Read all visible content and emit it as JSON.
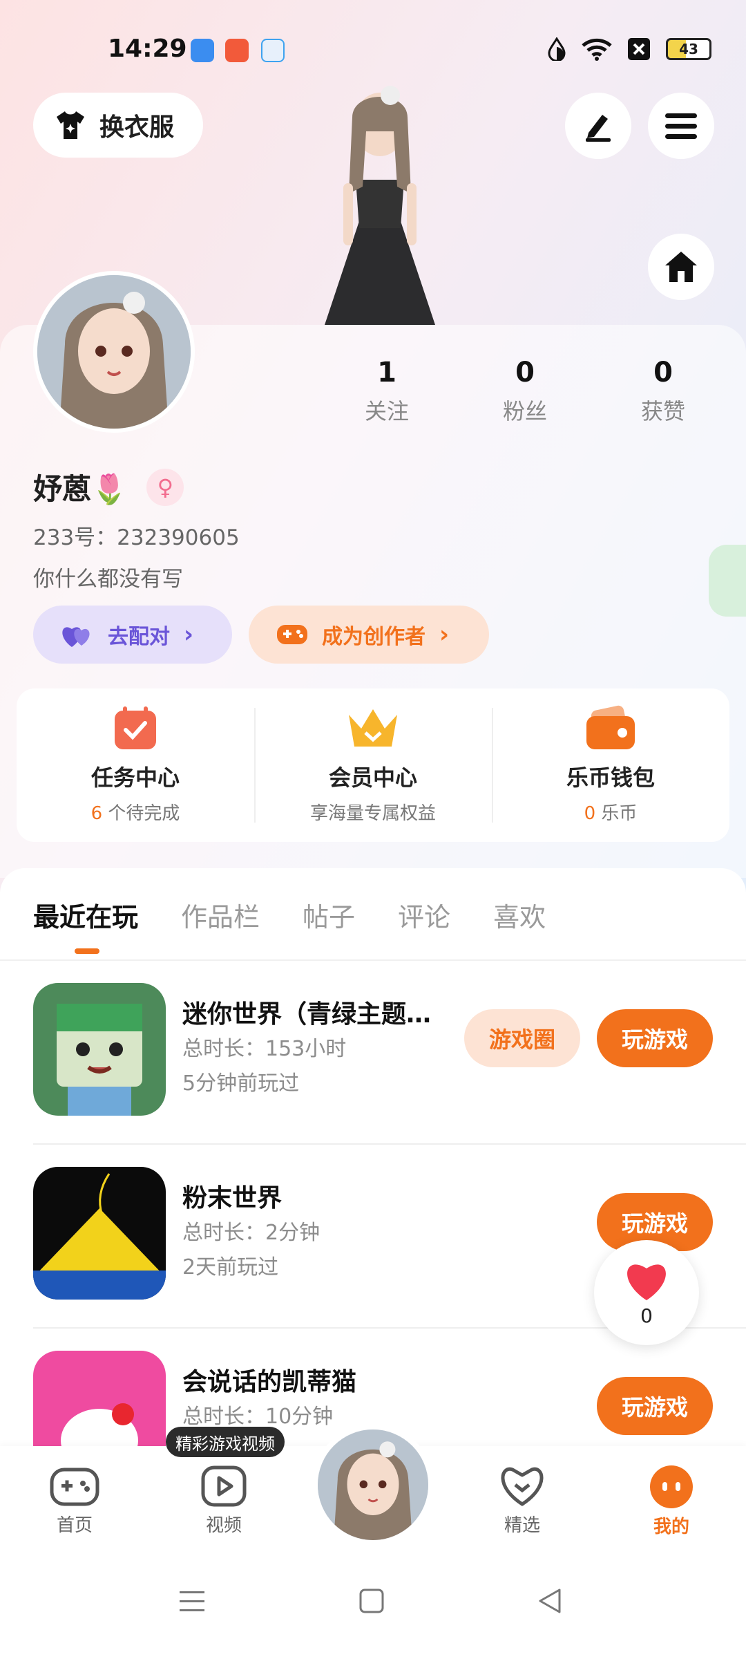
{
  "status_bar": {
    "time": "14:29",
    "battery": "43"
  },
  "header": {
    "outfit_label": "换衣服"
  },
  "profile": {
    "nickname": "妤蒽🌷",
    "uid": "233号：232390605",
    "bio": "你什么都没有写",
    "stats": [
      {
        "value": "1",
        "label": "关注"
      },
      {
        "value": "0",
        "label": "粉丝"
      },
      {
        "value": "0",
        "label": "获赞"
      }
    ],
    "match_label": "去配对",
    "creator_label": "成为创作者"
  },
  "quick_actions": [
    {
      "title": "任务中心",
      "count": "6",
      "suffix": " 个待完成",
      "icon": "calendar-check-icon"
    },
    {
      "title": "会员中心",
      "count": "",
      "suffix": "享海量专属权益",
      "icon": "crown-icon"
    },
    {
      "title": "乐币钱包",
      "count": "0",
      "suffix": " 乐币",
      "icon": "wallet-icon"
    }
  ],
  "tabs": [
    "最近在玩",
    "作品栏",
    "帖子",
    "评论",
    "喜欢"
  ],
  "games": [
    {
      "name": "迷你世界（青绿主题…",
      "duration": "总时长：153小时",
      "last_played": "5分钟前玩过",
      "circle_label": "游戏圈",
      "play_label": "玩游戏"
    },
    {
      "name": "粉末世界",
      "duration": "总时长：2分钟",
      "last_played": "2天前玩过",
      "play_label": "玩游戏"
    },
    {
      "name": "会说话的凯蒂猫",
      "duration": "总时长：10分钟",
      "play_label": "玩游戏"
    }
  ],
  "like_float": {
    "count": "0"
  },
  "bottom_nav": {
    "tooltip": "精彩游戏视频",
    "items": [
      "首页",
      "视频",
      "精选",
      "我的"
    ]
  },
  "colors": {
    "accent": "#f2711c",
    "match_purple": "#6a55d8"
  }
}
